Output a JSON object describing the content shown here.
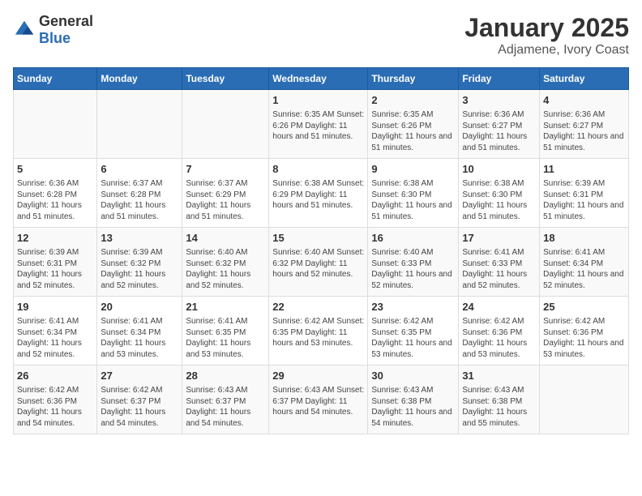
{
  "header": {
    "logo_general": "General",
    "logo_blue": "Blue",
    "month": "January 2025",
    "location": "Adjamene, Ivory Coast"
  },
  "weekdays": [
    "Sunday",
    "Monday",
    "Tuesday",
    "Wednesday",
    "Thursday",
    "Friday",
    "Saturday"
  ],
  "weeks": [
    [
      {
        "day": "",
        "info": ""
      },
      {
        "day": "",
        "info": ""
      },
      {
        "day": "",
        "info": ""
      },
      {
        "day": "1",
        "info": "Sunrise: 6:35 AM\nSunset: 6:26 PM\nDaylight: 11 hours\nand 51 minutes."
      },
      {
        "day": "2",
        "info": "Sunrise: 6:35 AM\nSunset: 6:26 PM\nDaylight: 11 hours\nand 51 minutes."
      },
      {
        "day": "3",
        "info": "Sunrise: 6:36 AM\nSunset: 6:27 PM\nDaylight: 11 hours\nand 51 minutes."
      },
      {
        "day": "4",
        "info": "Sunrise: 6:36 AM\nSunset: 6:27 PM\nDaylight: 11 hours\nand 51 minutes."
      }
    ],
    [
      {
        "day": "5",
        "info": "Sunrise: 6:36 AM\nSunset: 6:28 PM\nDaylight: 11 hours\nand 51 minutes."
      },
      {
        "day": "6",
        "info": "Sunrise: 6:37 AM\nSunset: 6:28 PM\nDaylight: 11 hours\nand 51 minutes."
      },
      {
        "day": "7",
        "info": "Sunrise: 6:37 AM\nSunset: 6:29 PM\nDaylight: 11 hours\nand 51 minutes."
      },
      {
        "day": "8",
        "info": "Sunrise: 6:38 AM\nSunset: 6:29 PM\nDaylight: 11 hours\nand 51 minutes."
      },
      {
        "day": "9",
        "info": "Sunrise: 6:38 AM\nSunset: 6:30 PM\nDaylight: 11 hours\nand 51 minutes."
      },
      {
        "day": "10",
        "info": "Sunrise: 6:38 AM\nSunset: 6:30 PM\nDaylight: 11 hours\nand 51 minutes."
      },
      {
        "day": "11",
        "info": "Sunrise: 6:39 AM\nSunset: 6:31 PM\nDaylight: 11 hours\nand 51 minutes."
      }
    ],
    [
      {
        "day": "12",
        "info": "Sunrise: 6:39 AM\nSunset: 6:31 PM\nDaylight: 11 hours\nand 52 minutes."
      },
      {
        "day": "13",
        "info": "Sunrise: 6:39 AM\nSunset: 6:32 PM\nDaylight: 11 hours\nand 52 minutes."
      },
      {
        "day": "14",
        "info": "Sunrise: 6:40 AM\nSunset: 6:32 PM\nDaylight: 11 hours\nand 52 minutes."
      },
      {
        "day": "15",
        "info": "Sunrise: 6:40 AM\nSunset: 6:32 PM\nDaylight: 11 hours\nand 52 minutes."
      },
      {
        "day": "16",
        "info": "Sunrise: 6:40 AM\nSunset: 6:33 PM\nDaylight: 11 hours\nand 52 minutes."
      },
      {
        "day": "17",
        "info": "Sunrise: 6:41 AM\nSunset: 6:33 PM\nDaylight: 11 hours\nand 52 minutes."
      },
      {
        "day": "18",
        "info": "Sunrise: 6:41 AM\nSunset: 6:34 PM\nDaylight: 11 hours\nand 52 minutes."
      }
    ],
    [
      {
        "day": "19",
        "info": "Sunrise: 6:41 AM\nSunset: 6:34 PM\nDaylight: 11 hours\nand 52 minutes."
      },
      {
        "day": "20",
        "info": "Sunrise: 6:41 AM\nSunset: 6:34 PM\nDaylight: 11 hours\nand 53 minutes."
      },
      {
        "day": "21",
        "info": "Sunrise: 6:41 AM\nSunset: 6:35 PM\nDaylight: 11 hours\nand 53 minutes."
      },
      {
        "day": "22",
        "info": "Sunrise: 6:42 AM\nSunset: 6:35 PM\nDaylight: 11 hours\nand 53 minutes."
      },
      {
        "day": "23",
        "info": "Sunrise: 6:42 AM\nSunset: 6:35 PM\nDaylight: 11 hours\nand 53 minutes."
      },
      {
        "day": "24",
        "info": "Sunrise: 6:42 AM\nSunset: 6:36 PM\nDaylight: 11 hours\nand 53 minutes."
      },
      {
        "day": "25",
        "info": "Sunrise: 6:42 AM\nSunset: 6:36 PM\nDaylight: 11 hours\nand 53 minutes."
      }
    ],
    [
      {
        "day": "26",
        "info": "Sunrise: 6:42 AM\nSunset: 6:36 PM\nDaylight: 11 hours\nand 54 minutes."
      },
      {
        "day": "27",
        "info": "Sunrise: 6:42 AM\nSunset: 6:37 PM\nDaylight: 11 hours\nand 54 minutes."
      },
      {
        "day": "28",
        "info": "Sunrise: 6:43 AM\nSunset: 6:37 PM\nDaylight: 11 hours\nand 54 minutes."
      },
      {
        "day": "29",
        "info": "Sunrise: 6:43 AM\nSunset: 6:37 PM\nDaylight: 11 hours\nand 54 minutes."
      },
      {
        "day": "30",
        "info": "Sunrise: 6:43 AM\nSunset: 6:38 PM\nDaylight: 11 hours\nand 54 minutes."
      },
      {
        "day": "31",
        "info": "Sunrise: 6:43 AM\nSunset: 6:38 PM\nDaylight: 11 hours\nand 55 minutes."
      },
      {
        "day": "",
        "info": ""
      }
    ]
  ]
}
